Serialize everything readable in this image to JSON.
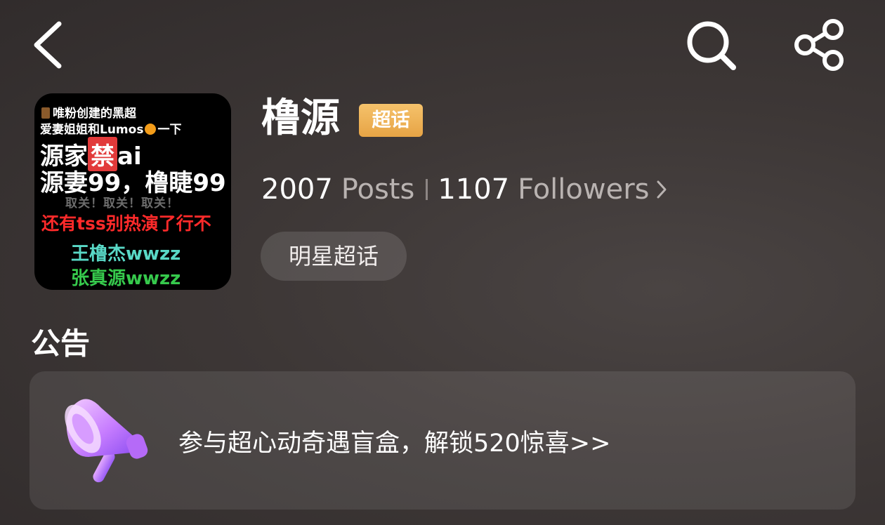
{
  "header": {
    "back_icon": "chevron-left-icon",
    "search_icon": "search-icon",
    "share_icon": "share-icon"
  },
  "avatar": {
    "line1": "唯粉创建的黑超",
    "line2_a": "爱妻姐姐和Lumos",
    "line2_b": "一下",
    "line3_a": "源家",
    "line3_ban": "禁",
    "line3_b": "ai",
    "line4": "源妻99，橹睫99",
    "line5": "取关！取关！取关！",
    "line6": "还有tss别热演了行不",
    "line7": "王橹杰wwzz",
    "line8": "张真源wwzz"
  },
  "profile": {
    "name": "橹源",
    "tag": "超话",
    "posts_count": "2007",
    "posts_label": "Posts",
    "followers_count": "1107",
    "followers_label": "Followers",
    "category": "明星超话"
  },
  "announcement": {
    "heading": "公告",
    "text": "参与超心动奇遇盲盒，解锁520惊喜>>",
    "icon": "megaphone-icon"
  },
  "colors": {
    "tag_bg": "#e7a445",
    "megaphone": "#c77dff"
  }
}
